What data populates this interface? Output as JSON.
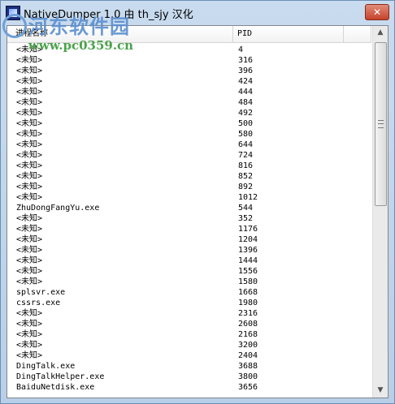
{
  "window": {
    "title": "NativeDumper 1.0 由 th_sjy 汉化",
    "close_label": "✕"
  },
  "watermark": {
    "name": "河东软件园",
    "url": "www.pc0359.cn"
  },
  "list": {
    "columns": [
      "进程名称",
      "PID",
      ""
    ],
    "rows": [
      {
        "name": "<未知>",
        "pid": "4"
      },
      {
        "name": "<未知>",
        "pid": "316"
      },
      {
        "name": "<未知>",
        "pid": "396"
      },
      {
        "name": "<未知>",
        "pid": "424"
      },
      {
        "name": "<未知>",
        "pid": "444"
      },
      {
        "name": "<未知>",
        "pid": "484"
      },
      {
        "name": "<未知>",
        "pid": "492"
      },
      {
        "name": "<未知>",
        "pid": "500"
      },
      {
        "name": "<未知>",
        "pid": "580"
      },
      {
        "name": "<未知>",
        "pid": "644"
      },
      {
        "name": "<未知>",
        "pid": "724"
      },
      {
        "name": "<未知>",
        "pid": "816"
      },
      {
        "name": "<未知>",
        "pid": "852"
      },
      {
        "name": "<未知>",
        "pid": "892"
      },
      {
        "name": "<未知>",
        "pid": "1012"
      },
      {
        "name": "ZhuDongFangYu.exe",
        "pid": "544"
      },
      {
        "name": "<未知>",
        "pid": "352"
      },
      {
        "name": "<未知>",
        "pid": "1176"
      },
      {
        "name": "<未知>",
        "pid": "1204"
      },
      {
        "name": "<未知>",
        "pid": "1396"
      },
      {
        "name": "<未知>",
        "pid": "1444"
      },
      {
        "name": "<未知>",
        "pid": "1556"
      },
      {
        "name": "<未知>",
        "pid": "1580"
      },
      {
        "name": "splsvr.exe",
        "pid": "1668"
      },
      {
        "name": "cssrs.exe",
        "pid": "1980"
      },
      {
        "name": "<未知>",
        "pid": "2316"
      },
      {
        "name": "<未知>",
        "pid": "2608"
      },
      {
        "name": "<未知>",
        "pid": "2168"
      },
      {
        "name": "<未知>",
        "pid": "3200"
      },
      {
        "name": "<未知>",
        "pid": "2404"
      },
      {
        "name": "DingTalk.exe",
        "pid": "3688"
      },
      {
        "name": "DingTalkHelper.exe",
        "pid": "3800"
      },
      {
        "name": "BaiduNetdisk.exe",
        "pid": "3656"
      }
    ]
  },
  "scrollbar": {
    "up_arrow": "▲",
    "down_arrow": "▼"
  }
}
